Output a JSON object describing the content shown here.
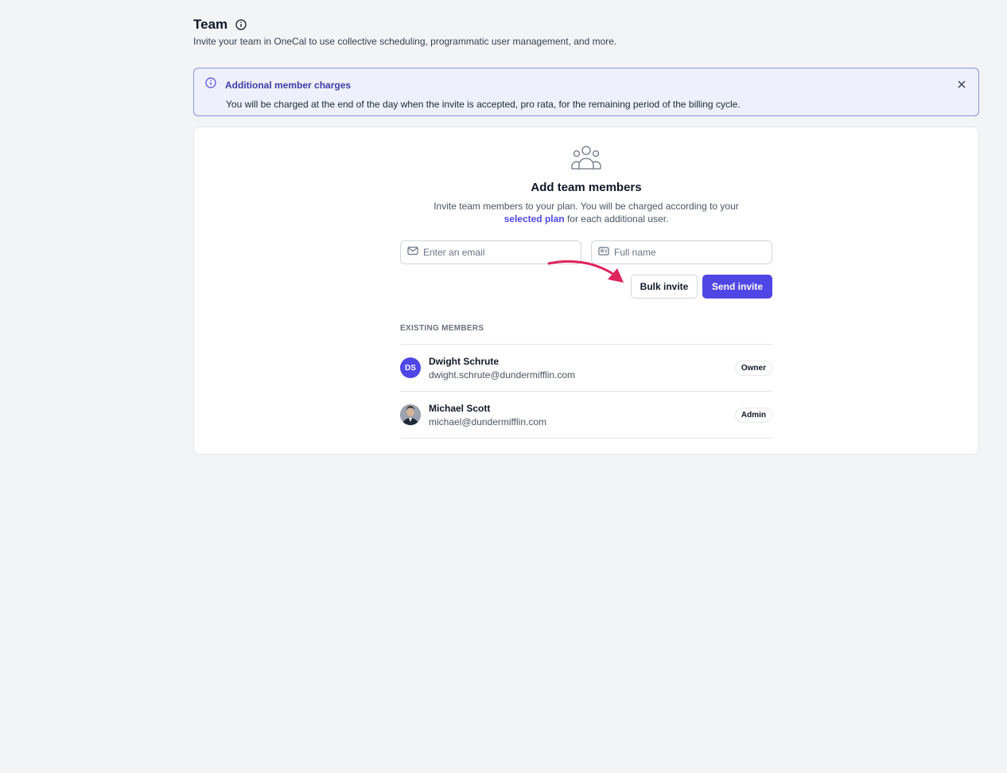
{
  "header": {
    "title": "Team",
    "subtitle": "Invite your team in OneCal to use collective scheduling, programmatic user management, and more."
  },
  "alert": {
    "title": "Additional member charges",
    "text": "You will be charged at the end of the day when the invite is accepted, pro rata, for the remaining period of the billing cycle."
  },
  "card": {
    "title": "Add team members",
    "desc_line1": "Invite team members to your plan. You will be charged according to your",
    "desc_link": "selected plan",
    "desc_line2_rest": " for each additional user.",
    "email_placeholder": "Enter an email",
    "name_placeholder": "Full name",
    "bulk_invite_label": "Bulk invite",
    "send_invite_label": "Send invite"
  },
  "members_section": {
    "label": "EXISTING MEMBERS",
    "members": [
      {
        "initials": "DS",
        "name": "Dwight Schrute",
        "email": "dwight.schrute@dundermifflin.com",
        "role": "Owner"
      },
      {
        "initials": "",
        "name": "Michael Scott",
        "email": "michael@dundermifflin.com",
        "role": "Admin"
      }
    ]
  },
  "colors": {
    "accent": "#4f46e5",
    "alert_bg": "#eef0fb",
    "alert_border": "#8b93d9",
    "arrow": "#e0245e"
  }
}
